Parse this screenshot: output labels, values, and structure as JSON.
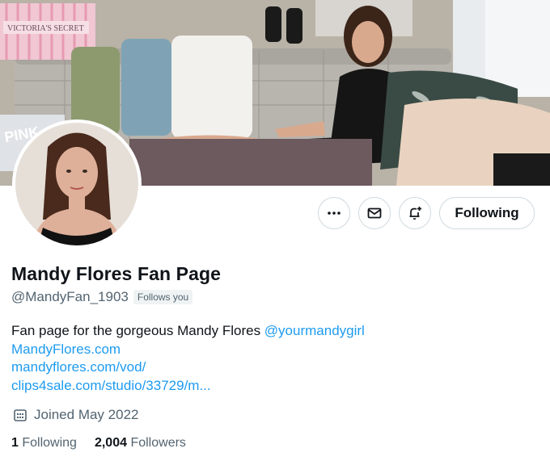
{
  "banner": {
    "box_text": "VICTORIA'S SECRET",
    "bag_text": "PINK"
  },
  "actions": {
    "more_icon": "more-horizontal-icon",
    "message_icon": "envelope-icon",
    "notify_icon": "bell-plus-icon",
    "following_label": "Following"
  },
  "profile": {
    "name": "Mandy Flores Fan Page",
    "handle": "@MandyFan_1903",
    "follows_you": "Follows you",
    "bio": {
      "text": "Fan page for the gorgeous Mandy Flores ",
      "mention": "@yourmandygirl",
      "link1": "MandyFlores.com",
      "link2": "mandyflores.com/vod/",
      "link3": "clips4sale.com/studio/33729/m..."
    },
    "joined_icon": "calendar-icon",
    "joined": "Joined May 2022",
    "following_count": "1",
    "following_label": "Following",
    "followers_count": "2,004",
    "followers_label": "Followers"
  },
  "colors": {
    "accent": "#1d9bf0",
    "muted": "#536471",
    "text": "#0f1419",
    "border": "#cfd9de"
  }
}
